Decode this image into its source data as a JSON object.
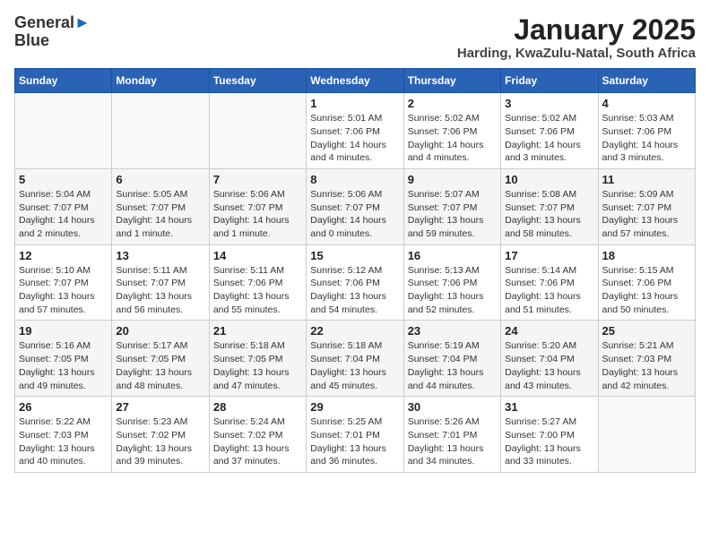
{
  "header": {
    "logo_line1": "General",
    "logo_line2": "Blue",
    "title": "January 2025",
    "subtitle": "Harding, KwaZulu-Natal, South Africa"
  },
  "weekdays": [
    "Sunday",
    "Monday",
    "Tuesday",
    "Wednesday",
    "Thursday",
    "Friday",
    "Saturday"
  ],
  "weeks": [
    [
      {
        "day": "",
        "info": ""
      },
      {
        "day": "",
        "info": ""
      },
      {
        "day": "",
        "info": ""
      },
      {
        "day": "1",
        "info": "Sunrise: 5:01 AM\nSunset: 7:06 PM\nDaylight: 14 hours\nand 4 minutes."
      },
      {
        "day": "2",
        "info": "Sunrise: 5:02 AM\nSunset: 7:06 PM\nDaylight: 14 hours\nand 4 minutes."
      },
      {
        "day": "3",
        "info": "Sunrise: 5:02 AM\nSunset: 7:06 PM\nDaylight: 14 hours\nand 3 minutes."
      },
      {
        "day": "4",
        "info": "Sunrise: 5:03 AM\nSunset: 7:06 PM\nDaylight: 14 hours\nand 3 minutes."
      }
    ],
    [
      {
        "day": "5",
        "info": "Sunrise: 5:04 AM\nSunset: 7:07 PM\nDaylight: 14 hours\nand 2 minutes."
      },
      {
        "day": "6",
        "info": "Sunrise: 5:05 AM\nSunset: 7:07 PM\nDaylight: 14 hours\nand 1 minute."
      },
      {
        "day": "7",
        "info": "Sunrise: 5:06 AM\nSunset: 7:07 PM\nDaylight: 14 hours\nand 1 minute."
      },
      {
        "day": "8",
        "info": "Sunrise: 5:06 AM\nSunset: 7:07 PM\nDaylight: 14 hours\nand 0 minutes."
      },
      {
        "day": "9",
        "info": "Sunrise: 5:07 AM\nSunset: 7:07 PM\nDaylight: 13 hours\nand 59 minutes."
      },
      {
        "day": "10",
        "info": "Sunrise: 5:08 AM\nSunset: 7:07 PM\nDaylight: 13 hours\nand 58 minutes."
      },
      {
        "day": "11",
        "info": "Sunrise: 5:09 AM\nSunset: 7:07 PM\nDaylight: 13 hours\nand 57 minutes."
      }
    ],
    [
      {
        "day": "12",
        "info": "Sunrise: 5:10 AM\nSunset: 7:07 PM\nDaylight: 13 hours\nand 57 minutes."
      },
      {
        "day": "13",
        "info": "Sunrise: 5:11 AM\nSunset: 7:07 PM\nDaylight: 13 hours\nand 56 minutes."
      },
      {
        "day": "14",
        "info": "Sunrise: 5:11 AM\nSunset: 7:06 PM\nDaylight: 13 hours\nand 55 minutes."
      },
      {
        "day": "15",
        "info": "Sunrise: 5:12 AM\nSunset: 7:06 PM\nDaylight: 13 hours\nand 54 minutes."
      },
      {
        "day": "16",
        "info": "Sunrise: 5:13 AM\nSunset: 7:06 PM\nDaylight: 13 hours\nand 52 minutes."
      },
      {
        "day": "17",
        "info": "Sunrise: 5:14 AM\nSunset: 7:06 PM\nDaylight: 13 hours\nand 51 minutes."
      },
      {
        "day": "18",
        "info": "Sunrise: 5:15 AM\nSunset: 7:06 PM\nDaylight: 13 hours\nand 50 minutes."
      }
    ],
    [
      {
        "day": "19",
        "info": "Sunrise: 5:16 AM\nSunset: 7:05 PM\nDaylight: 13 hours\nand 49 minutes."
      },
      {
        "day": "20",
        "info": "Sunrise: 5:17 AM\nSunset: 7:05 PM\nDaylight: 13 hours\nand 48 minutes."
      },
      {
        "day": "21",
        "info": "Sunrise: 5:18 AM\nSunset: 7:05 PM\nDaylight: 13 hours\nand 47 minutes."
      },
      {
        "day": "22",
        "info": "Sunrise: 5:18 AM\nSunset: 7:04 PM\nDaylight: 13 hours\nand 45 minutes."
      },
      {
        "day": "23",
        "info": "Sunrise: 5:19 AM\nSunset: 7:04 PM\nDaylight: 13 hours\nand 44 minutes."
      },
      {
        "day": "24",
        "info": "Sunrise: 5:20 AM\nSunset: 7:04 PM\nDaylight: 13 hours\nand 43 minutes."
      },
      {
        "day": "25",
        "info": "Sunrise: 5:21 AM\nSunset: 7:03 PM\nDaylight: 13 hours\nand 42 minutes."
      }
    ],
    [
      {
        "day": "26",
        "info": "Sunrise: 5:22 AM\nSunset: 7:03 PM\nDaylight: 13 hours\nand 40 minutes."
      },
      {
        "day": "27",
        "info": "Sunrise: 5:23 AM\nSunset: 7:02 PM\nDaylight: 13 hours\nand 39 minutes."
      },
      {
        "day": "28",
        "info": "Sunrise: 5:24 AM\nSunset: 7:02 PM\nDaylight: 13 hours\nand 37 minutes."
      },
      {
        "day": "29",
        "info": "Sunrise: 5:25 AM\nSunset: 7:01 PM\nDaylight: 13 hours\nand 36 minutes."
      },
      {
        "day": "30",
        "info": "Sunrise: 5:26 AM\nSunset: 7:01 PM\nDaylight: 13 hours\nand 34 minutes."
      },
      {
        "day": "31",
        "info": "Sunrise: 5:27 AM\nSunset: 7:00 PM\nDaylight: 13 hours\nand 33 minutes."
      },
      {
        "day": "",
        "info": ""
      }
    ]
  ]
}
